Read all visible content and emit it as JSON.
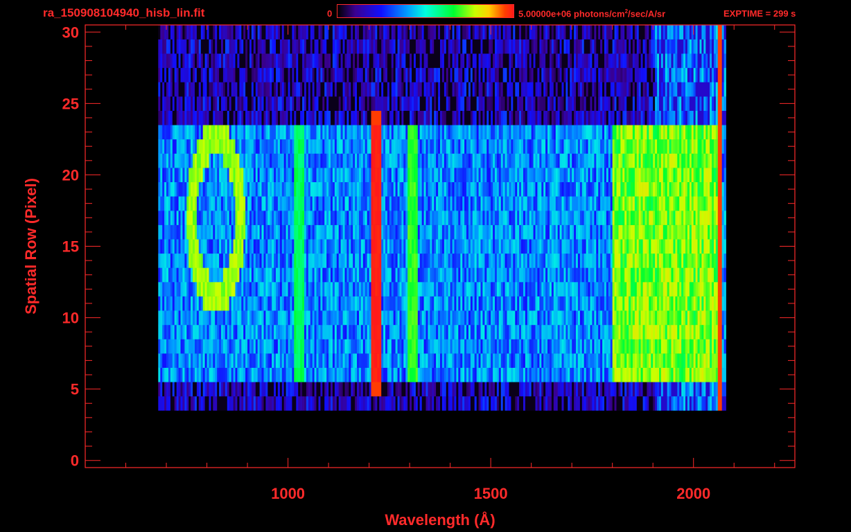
{
  "header": {
    "file_title": "ra_150908104940_hisb_lin.fit",
    "colorbar_min": "0",
    "colorbar_max_value": "5.00000e+06 photons/cm",
    "colorbar_max_exp": "2",
    "colorbar_max_unit_rest": "/sec/A/sr",
    "exptime": "EXPTIME = 299 s"
  },
  "colors": {
    "axis": "#ff2a2a",
    "background": "#000000",
    "colormap": [
      "#000000",
      "#3a0090",
      "#1010ff",
      "#00a0ff",
      "#00ffe0",
      "#00ff30",
      "#c8ff00",
      "#ffd000",
      "#ff4000",
      "#ff1a1a"
    ]
  },
  "chart_data": {
    "type": "heatmap",
    "xlabel": "Wavelength (Å)",
    "ylabel": "Spatial Row (Pixel)",
    "xlim": [
      500,
      2250
    ],
    "ylim": [
      -0.5,
      30.5
    ],
    "x_ticks": [
      1000,
      1500,
      2000
    ],
    "y_ticks": [
      0,
      5,
      10,
      15,
      20,
      25,
      30
    ],
    "colorbar": {
      "min": 0,
      "max": 5000000,
      "unit": "photons/cm^2/sec/A/sr"
    },
    "signal_rows": [
      6,
      23
    ],
    "noise_rows": [
      4,
      30
    ],
    "wavelength_coverage": [
      680,
      2080
    ],
    "features": [
      {
        "name": "ring (O I)",
        "center_x": 820,
        "center_y": 17,
        "intensity": 0.6
      },
      {
        "x": 1025,
        "rows": [
          6,
          23
        ],
        "intensity": 0.5
      },
      {
        "x": 1216,
        "rows": [
          5,
          24
        ],
        "intensity": 0.95
      },
      {
        "x": 1304,
        "rows": [
          6,
          23
        ],
        "intensity": 0.55
      },
      {
        "x_range": [
          1800,
          2060
        ],
        "rows": [
          6,
          23
        ],
        "intensity": 0.65
      },
      {
        "x": 2062,
        "rows": [
          2,
          30
        ],
        "intensity": 0.9
      }
    ]
  }
}
